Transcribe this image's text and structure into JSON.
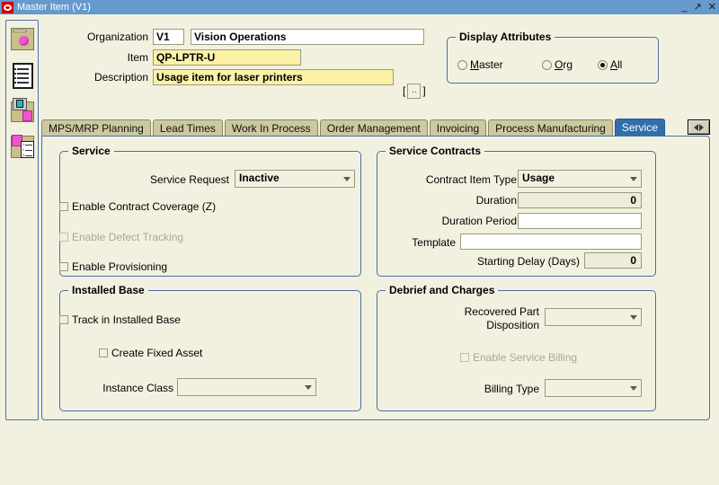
{
  "window": {
    "title": "Master Item (V1)",
    "logo_icon": "oracle-logo-icon",
    "buttons": [
      {
        "name": "minimize-button",
        "glyph": "_"
      },
      {
        "name": "restore-button",
        "glyph": "↗"
      },
      {
        "name": "close-button",
        "glyph": "✕"
      }
    ]
  },
  "sidebar": {
    "items": [
      {
        "icon": "folder-item-icon",
        "label": "Master Item"
      },
      {
        "icon": "list-document-icon",
        "label": "Item List"
      },
      {
        "icon": "organization-item-icon",
        "label": "Organization Item"
      },
      {
        "icon": "item-catalog-icon",
        "label": "Item Catalog"
      }
    ]
  },
  "header": {
    "organization_label": "Organization",
    "organization_code": "V1",
    "organization_name": "Vision Operations",
    "item_label": "Item",
    "item_value": "QP-LPTR-U",
    "description_label": "Description",
    "description_value": "Usage item for laser printers",
    "dff_open_bracket": "[",
    "dff_button_label": "..",
    "dff_close_bracket": "]"
  },
  "display_attributes": {
    "title": "Display Attributes",
    "options": [
      {
        "label": "Master",
        "mnemonic": "M",
        "selected": false
      },
      {
        "label": "Org",
        "mnemonic": "O",
        "selected": false
      },
      {
        "label": "All",
        "mnemonic": "A",
        "selected": true
      }
    ]
  },
  "tabs": [
    {
      "label": "MPS/MRP Planning",
      "active": false
    },
    {
      "label": "Lead Times",
      "active": false
    },
    {
      "label": "Work In Process",
      "active": false
    },
    {
      "label": "Order Management",
      "active": false
    },
    {
      "label": "Invoicing",
      "active": false
    },
    {
      "label": "Process Manufacturing",
      "active": false
    },
    {
      "label": "Service",
      "active": true
    }
  ],
  "tab_scroll": {
    "name": "tab-scroll-button"
  },
  "service": {
    "title": "Service",
    "service_request_label": "Service Request",
    "service_request_value": "Inactive",
    "checkboxes": [
      {
        "label": "Enable Contract Coverage (Z)",
        "checked": false,
        "disabled": false
      },
      {
        "label": "Enable Defect Tracking",
        "checked": false,
        "disabled": true
      },
      {
        "label": "Enable Provisioning",
        "checked": false,
        "disabled": false
      }
    ]
  },
  "service_contracts": {
    "title": "Service Contracts",
    "contract_item_type_label": "Contract Item Type",
    "contract_item_type_value": "Usage",
    "duration_label": "Duration",
    "duration_value": "0",
    "duration_period_label": "Duration Period",
    "duration_period_value": "",
    "template_label": "Template",
    "template_value": "",
    "starting_delay_label": "Starting Delay (Days)",
    "starting_delay_value": "0"
  },
  "installed_base": {
    "title": "Installed Base",
    "track_label": "Track in Installed Base",
    "create_fixed_asset_label": "Create Fixed Asset",
    "instance_class_label": "Instance Class",
    "instance_class_value": ""
  },
  "debrief_and_charges": {
    "title": "Debrief and Charges",
    "recovered_part_label_line1": "Recovered Part",
    "recovered_part_label_line2": "Disposition",
    "recovered_part_value": "",
    "enable_service_billing_label": "Enable Service Billing",
    "billing_type_label": "Billing Type",
    "billing_type_value": ""
  },
  "colors": {
    "titlebar": "#6699cc",
    "canvas": "#f2f1e0",
    "required_field": "#fbf2a8",
    "readonly_field": "#edecd8",
    "group_border": "#486fa3",
    "tab_inactive": "#ccc8a0",
    "tab_active": "#2f6fab"
  }
}
